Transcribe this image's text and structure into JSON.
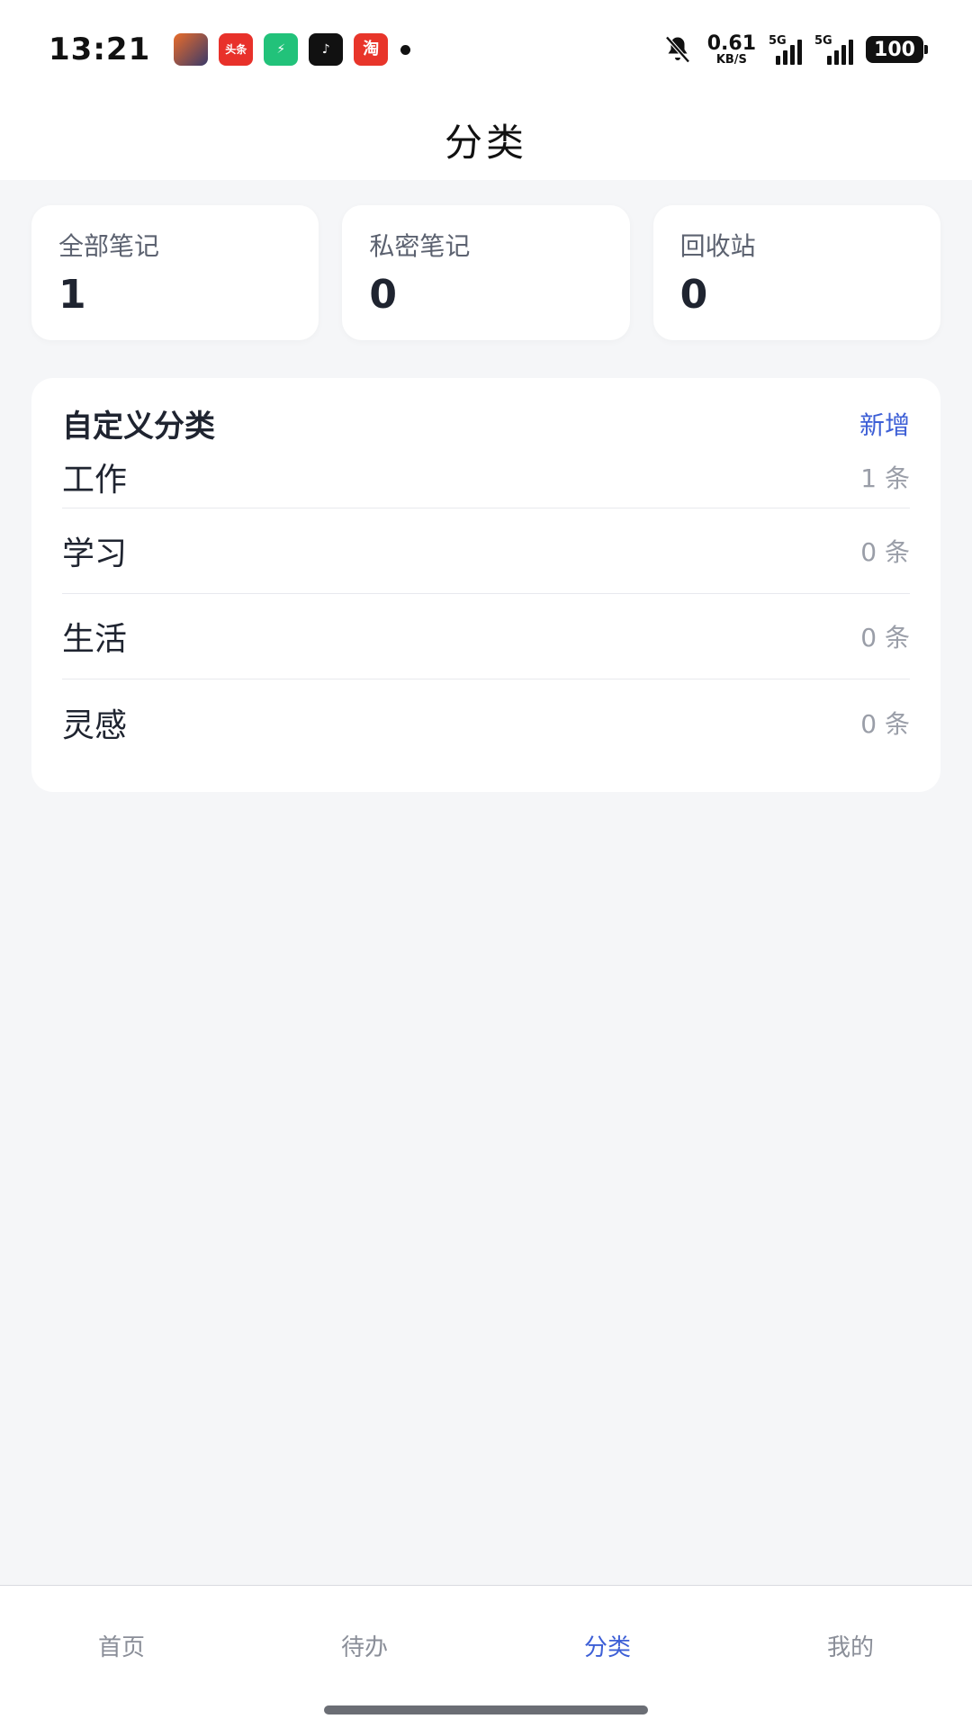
{
  "status_bar": {
    "time": "13:21",
    "app_icons": [
      {
        "name": "game-app-icon",
        "glyph": ""
      },
      {
        "name": "toutiao-app-icon",
        "glyph": "头条"
      },
      {
        "name": "battery-app-icon",
        "glyph": "⚡"
      },
      {
        "name": "tiktok-app-icon",
        "glyph": "♪"
      },
      {
        "name": "taobao-app-icon",
        "glyph": "淘"
      }
    ],
    "net_speed_value": "0.61",
    "net_speed_unit": "KB/S",
    "signal1_label": "5G",
    "signal2_label": "5G",
    "battery": "100"
  },
  "header": {
    "title": "分类"
  },
  "stats": [
    {
      "label": "全部笔记",
      "value": "1"
    },
    {
      "label": "私密笔记",
      "value": "0"
    },
    {
      "label": "回收站",
      "value": "0"
    }
  ],
  "categories": {
    "title": "自定义分类",
    "add_label": "新增",
    "items": [
      {
        "name": "工作",
        "count": "1 条"
      },
      {
        "name": "学习",
        "count": "0 条"
      },
      {
        "name": "生活",
        "count": "0 条"
      },
      {
        "name": "灵感",
        "count": "0 条"
      }
    ]
  },
  "tabbar": {
    "tabs": [
      {
        "label": "首页",
        "active": false
      },
      {
        "label": "待办",
        "active": false
      },
      {
        "label": "分类",
        "active": true
      },
      {
        "label": "我的",
        "active": false
      }
    ]
  },
  "colors": {
    "accent": "#3d5fd6",
    "background": "#f5f6f8",
    "card": "#ffffff"
  }
}
